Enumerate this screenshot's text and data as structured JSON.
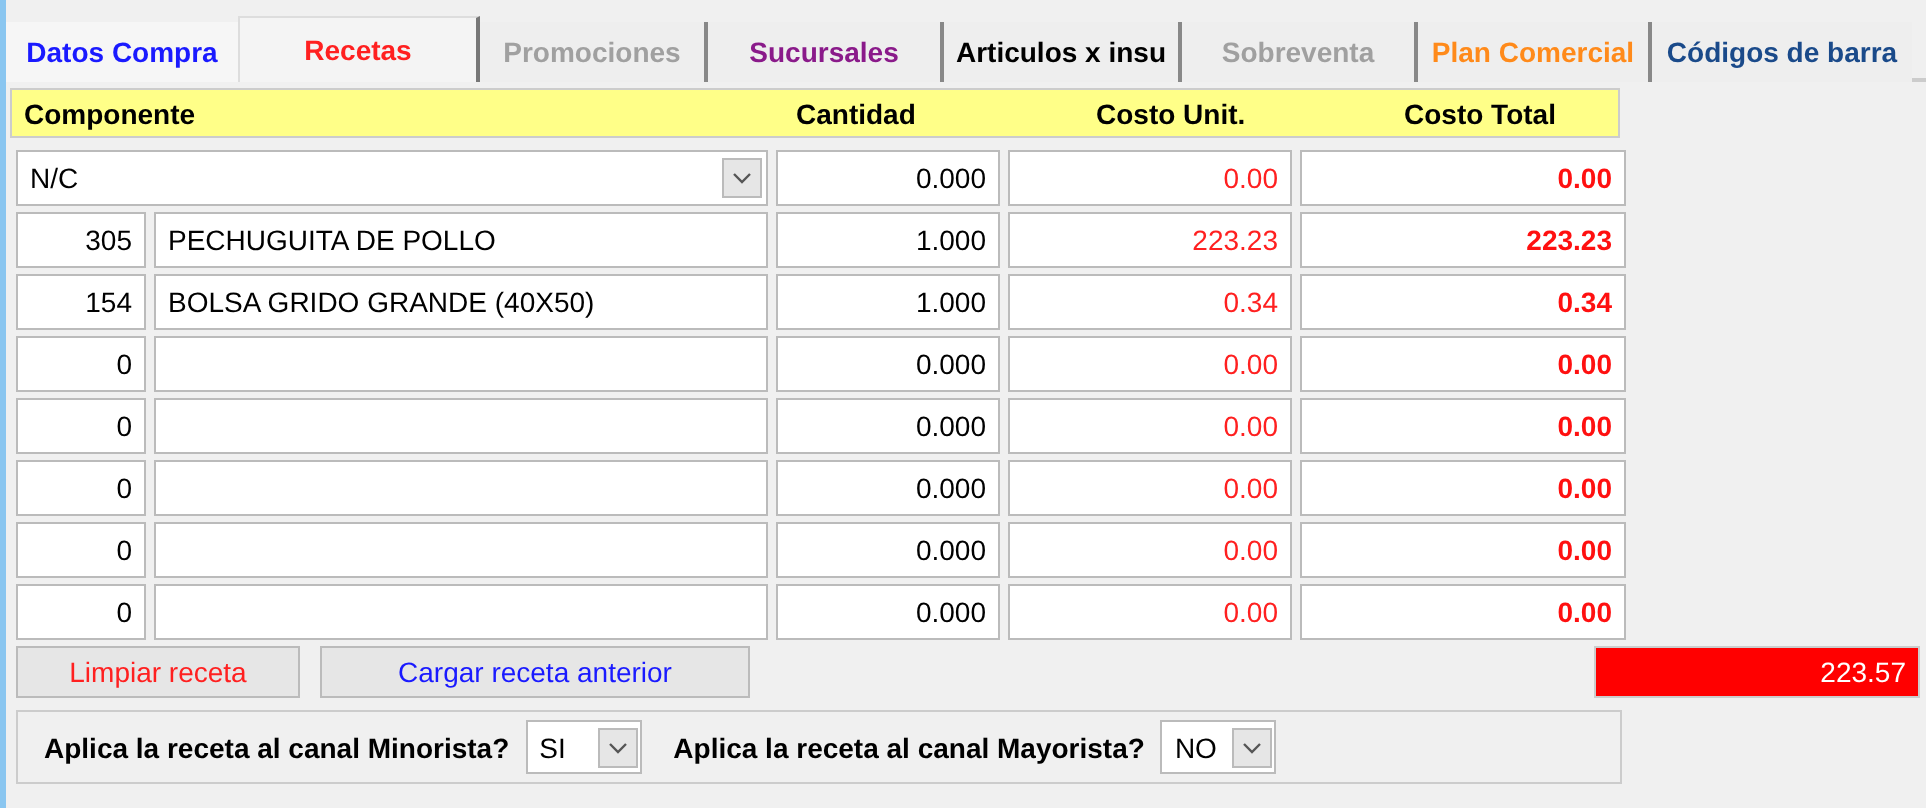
{
  "tabs": [
    {
      "label": "Datos Compra",
      "color": "#1a1aff",
      "selected": false
    },
    {
      "label": "Recetas",
      "color": "#ff2020",
      "selected": true
    },
    {
      "label": "Promociones",
      "color": "#a0a0a0",
      "selected": false
    },
    {
      "label": "Sucursales",
      "color": "#8a1a8a",
      "selected": false
    },
    {
      "label": "Articulos x insu",
      "color": "#000000",
      "selected": false
    },
    {
      "label": "Sobreventa",
      "color": "#a0a0a0",
      "selected": false
    },
    {
      "label": "Plan Comercial",
      "color": "#ff8a1a",
      "selected": false
    },
    {
      "label": "Códigos de barra",
      "color": "#1a4a8a",
      "selected": false
    }
  ],
  "table": {
    "columns": [
      "Componente",
      "Cantidad",
      "Costo Unit.",
      "Costo Total"
    ],
    "rows": [
      {
        "kind": "select",
        "component": "N/C",
        "quantity": "0.000",
        "unit_cost": "0.00",
        "total_cost": "0.00"
      },
      {
        "kind": "item",
        "code": "305",
        "component": "PECHUGUITA DE POLLO",
        "quantity": "1.000",
        "unit_cost": "223.23",
        "total_cost": "223.23"
      },
      {
        "kind": "item",
        "code": "154",
        "component": "BOLSA GRIDO GRANDE (40X50)",
        "quantity": "1.000",
        "unit_cost": "0.34",
        "total_cost": "0.34"
      },
      {
        "kind": "item",
        "code": "0",
        "quantity": "0.000",
        "unit_cost": "0.00",
        "total_cost": "0.00"
      },
      {
        "kind": "item",
        "code": "0",
        "quantity": "0.000",
        "unit_cost": "0.00",
        "total_cost": "0.00"
      },
      {
        "kind": "item",
        "code": "0",
        "quantity": "0.000",
        "unit_cost": "0.00",
        "total_cost": "0.00"
      },
      {
        "kind": "item",
        "code": "0",
        "quantity": "0.000",
        "unit_cost": "0.00",
        "total_cost": "0.00"
      },
      {
        "kind": "item",
        "code": "0",
        "quantity": "0.000",
        "unit_cost": "0.00",
        "total_cost": "0.00"
      }
    ]
  },
  "buttons": [
    {
      "label": "Limpiar receta",
      "color": "#ff2020"
    },
    {
      "label": "Cargar receta anterior",
      "color": "#1a1aff"
    }
  ],
  "total": "223.57",
  "channels": [
    {
      "label": "Aplica la receta al canal Minorista?",
      "value": "SI"
    },
    {
      "label": "Aplica la receta al canal Mayorista?",
      "value": "NO"
    }
  ]
}
